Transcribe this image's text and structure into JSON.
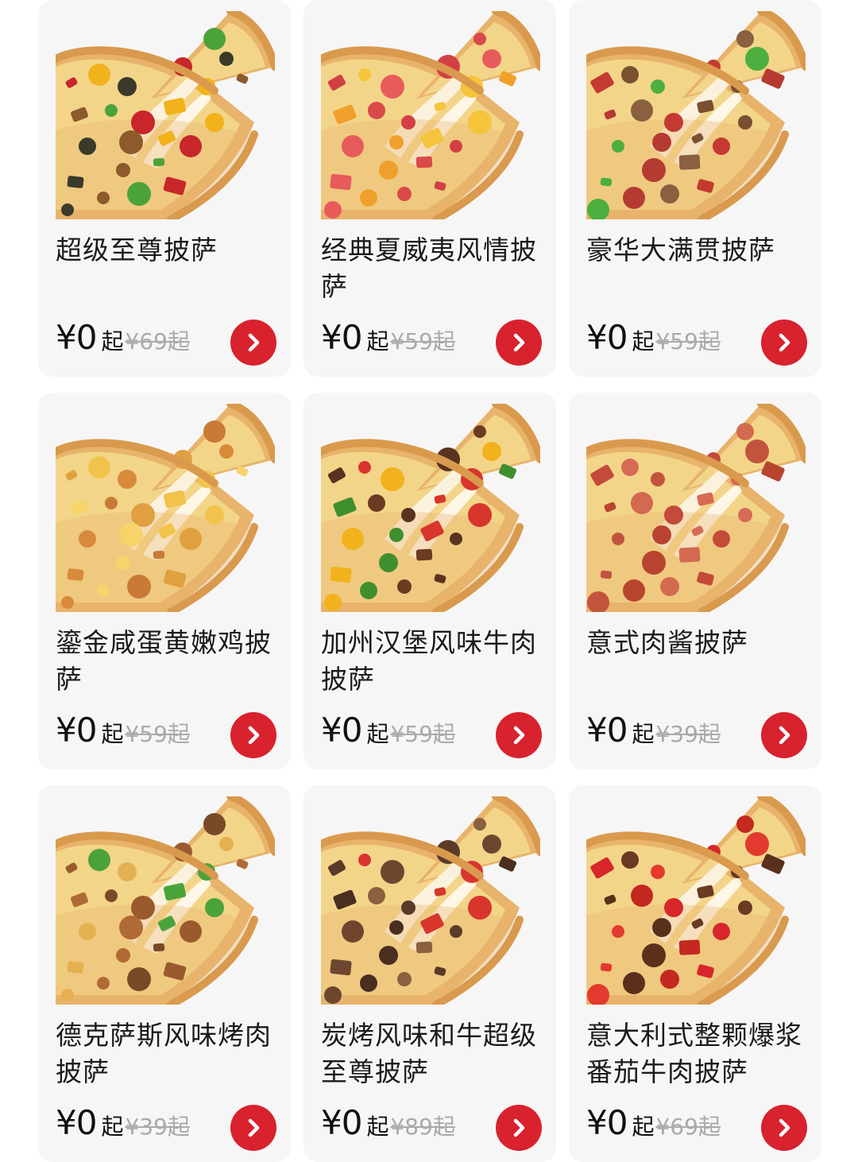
{
  "colors": {
    "accent": "#d8222e",
    "card_bg": "#f6f6f6",
    "strike": "#aaaaaa"
  },
  "products": [
    {
      "name": "超级至尊披萨",
      "price": "¥0",
      "price_suffix": "起",
      "original_price": "¥69起",
      "icon": "chevron-right-icon"
    },
    {
      "name": "经典夏威夷风情披萨",
      "price": "¥0",
      "price_suffix": "起",
      "original_price": "¥59起",
      "icon": "chevron-right-icon"
    },
    {
      "name": "豪华大满贯披萨",
      "price": "¥0",
      "price_suffix": "起",
      "original_price": "¥59起",
      "icon": "chevron-right-icon"
    },
    {
      "name": "鎏金咸蛋黄嫩鸡披萨",
      "price": "¥0",
      "price_suffix": "起",
      "original_price": "¥59起",
      "icon": "chevron-right-icon"
    },
    {
      "name": "加州汉堡风味牛肉披萨",
      "price": "¥0",
      "price_suffix": "起",
      "original_price": "¥59起",
      "icon": "chevron-right-icon"
    },
    {
      "name": "意式肉酱披萨",
      "price": "¥0",
      "price_suffix": "起",
      "original_price": "¥39起",
      "icon": "chevron-right-icon"
    },
    {
      "name": "德克萨斯风味烤肉披萨",
      "price": "¥0",
      "price_suffix": "起",
      "original_price": "¥39起",
      "icon": "chevron-right-icon"
    },
    {
      "name": "炭烤风味和牛超级至尊披萨",
      "price": "¥0",
      "price_suffix": "起",
      "original_price": "¥89起",
      "icon": "chevron-right-icon"
    },
    {
      "name": "意大利式整颗爆浆番茄牛肉披萨",
      "price": "¥0",
      "price_suffix": "起",
      "original_price": "¥69起",
      "icon": "chevron-right-icon"
    }
  ]
}
